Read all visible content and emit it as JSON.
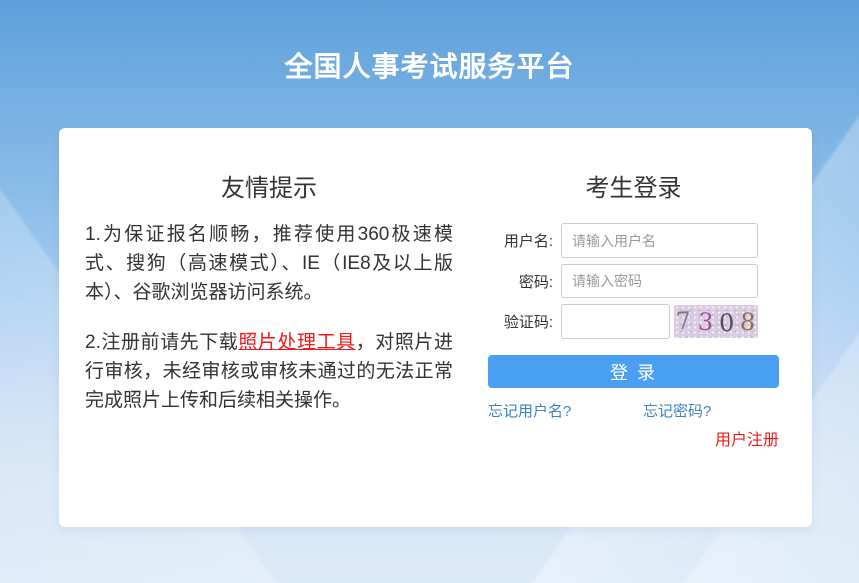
{
  "header": {
    "title": "全国人事考试服务平台"
  },
  "tips": {
    "heading": "友情提示",
    "para1": "1.为保证报名顺畅，推荐使用360极速模式、搜狗（高速模式）、IE（IE8及以上版本）、谷歌浏览器访问系统。",
    "para2_prefix": "2.注册前请先下载",
    "para2_link": "照片处理工具",
    "para2_suffix": "，对照片进行审核，未经审核或审核未通过的无法正常完成照片上传和后续相关操作。"
  },
  "login": {
    "heading": "考生登录",
    "username_label": "用户名:",
    "username_placeholder": "请输入用户名",
    "password_label": "密码:",
    "password_placeholder": "请输入密码",
    "captcha_label": "验证码:",
    "captcha_value": "7308",
    "captcha_digits": [
      {
        "char": "7",
        "color": "#7E7787"
      },
      {
        "char": "3",
        "color": "#A4509C"
      },
      {
        "char": "0",
        "color": "#524C59"
      },
      {
        "char": "8",
        "color": "#8E7147"
      }
    ],
    "login_button": "登 录",
    "forgot_username": "忘记用户名?",
    "forgot_password": "忘记密码?",
    "register": "用户注册"
  },
  "colors": {
    "accent": "#4A9FF0",
    "link": "#4082C4",
    "red": "#F01818",
    "captcha_background": "#D9CCE3"
  }
}
